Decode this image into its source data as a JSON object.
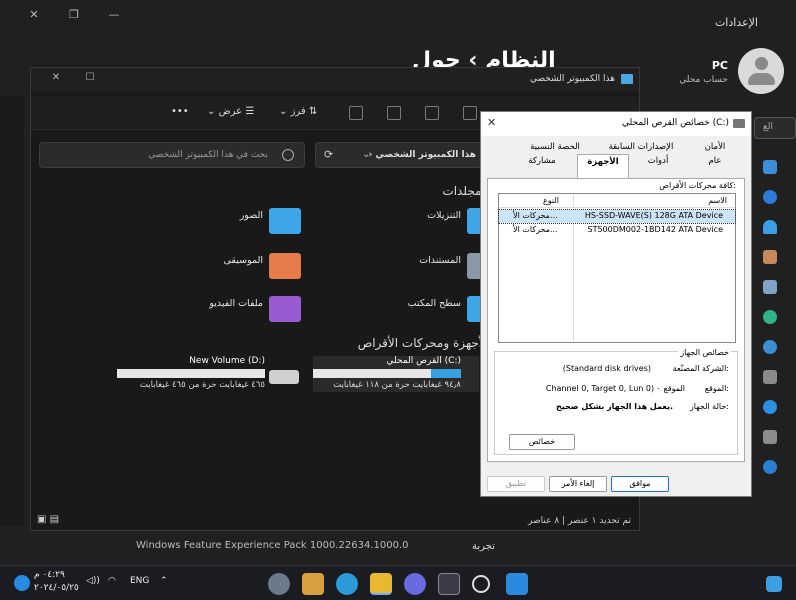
{
  "settings": {
    "title": "الإعدادات",
    "page_title": "النظام › حول",
    "account_name": "PC",
    "account_type": "حساب محلي",
    "search_stub": "الع",
    "bottom_line1": "Windows Feature Experience Pack 1000.22634.1000.0",
    "bottom_line2": "تجربة"
  },
  "explorer": {
    "title": "هذا الكمبيوتر الشخصي",
    "toolbar": {
      "view_label": "عرض",
      "sort_label": "فرز",
      "more_label": "•••"
    },
    "search_placeholder": "بحث في هذا الكمبيوتر الشخصي",
    "address": "هذا الكمبيوتر الشخصي",
    "folders_title": "المجلدات",
    "folders": [
      {
        "name": "التنزيلات"
      },
      {
        "name": "الصور"
      },
      {
        "name": "المستندات"
      },
      {
        "name": "الموسيقى"
      },
      {
        "name": "سطح المكتب"
      },
      {
        "name": "ملفات الفيديو"
      }
    ],
    "drives_title": "الأجهزة ومحركات الأقراص",
    "drives": [
      {
        "name": "القرص المحلي (C:)",
        "free_text": "٩٤٫٨ غيغابايت حرة من ١١٨ غيغابايت",
        "used_fraction": 0.2
      },
      {
        "name": "New Volume (D:)",
        "free_text": "٤٦٥ غيغابايت حرة من ٤٦٥ غيغابايت",
        "used_fraction": 0.0
      }
    ],
    "status_items": "٨ عناصر",
    "status_selected": "تم تحديد ١ عنصر"
  },
  "properties": {
    "title": "خصائص القرص المحلي (C:)",
    "tabs_row1": [
      "الأمان",
      "الإصدارات السابقة",
      "الحصة النسبية"
    ],
    "tabs_row2": [
      "عام",
      "أدوات",
      "الأجهزة",
      "مشاركة"
    ],
    "all_drives_label": "كافة محركات الأقراص:",
    "col_name": "الاسم",
    "col_type": "النوع",
    "rows": [
      {
        "name": "HS-SSD-WAVE(S) 128G ATA Device",
        "type": "محركات الأ..."
      },
      {
        "name": "ST500DM002-1BD142 ATA Device",
        "type": "محركات الأ..."
      }
    ],
    "device_props_label": "خصائص الجهاز",
    "manufacturer_label": "الشركة المصنّعة:",
    "manufacturer_value": "(Standard disk drives)",
    "location_label": "الموقع:",
    "location_value": "Channel 0, Target 0, Lun 0) الموقع ٠",
    "status_label": "حالة الجهاز:",
    "status_value": "يعمل هذا الجهاز بشكل صحيح.",
    "properties_button": "خصائص",
    "ok_button": "موافق",
    "cancel_button": "إلغاء الأمر",
    "apply_button": "تطبيق"
  },
  "taskbar": {
    "time": "٠٤:٢٩ م",
    "date": "٢٠٢٤/٠٥/٢٥",
    "lang": "ENG"
  }
}
